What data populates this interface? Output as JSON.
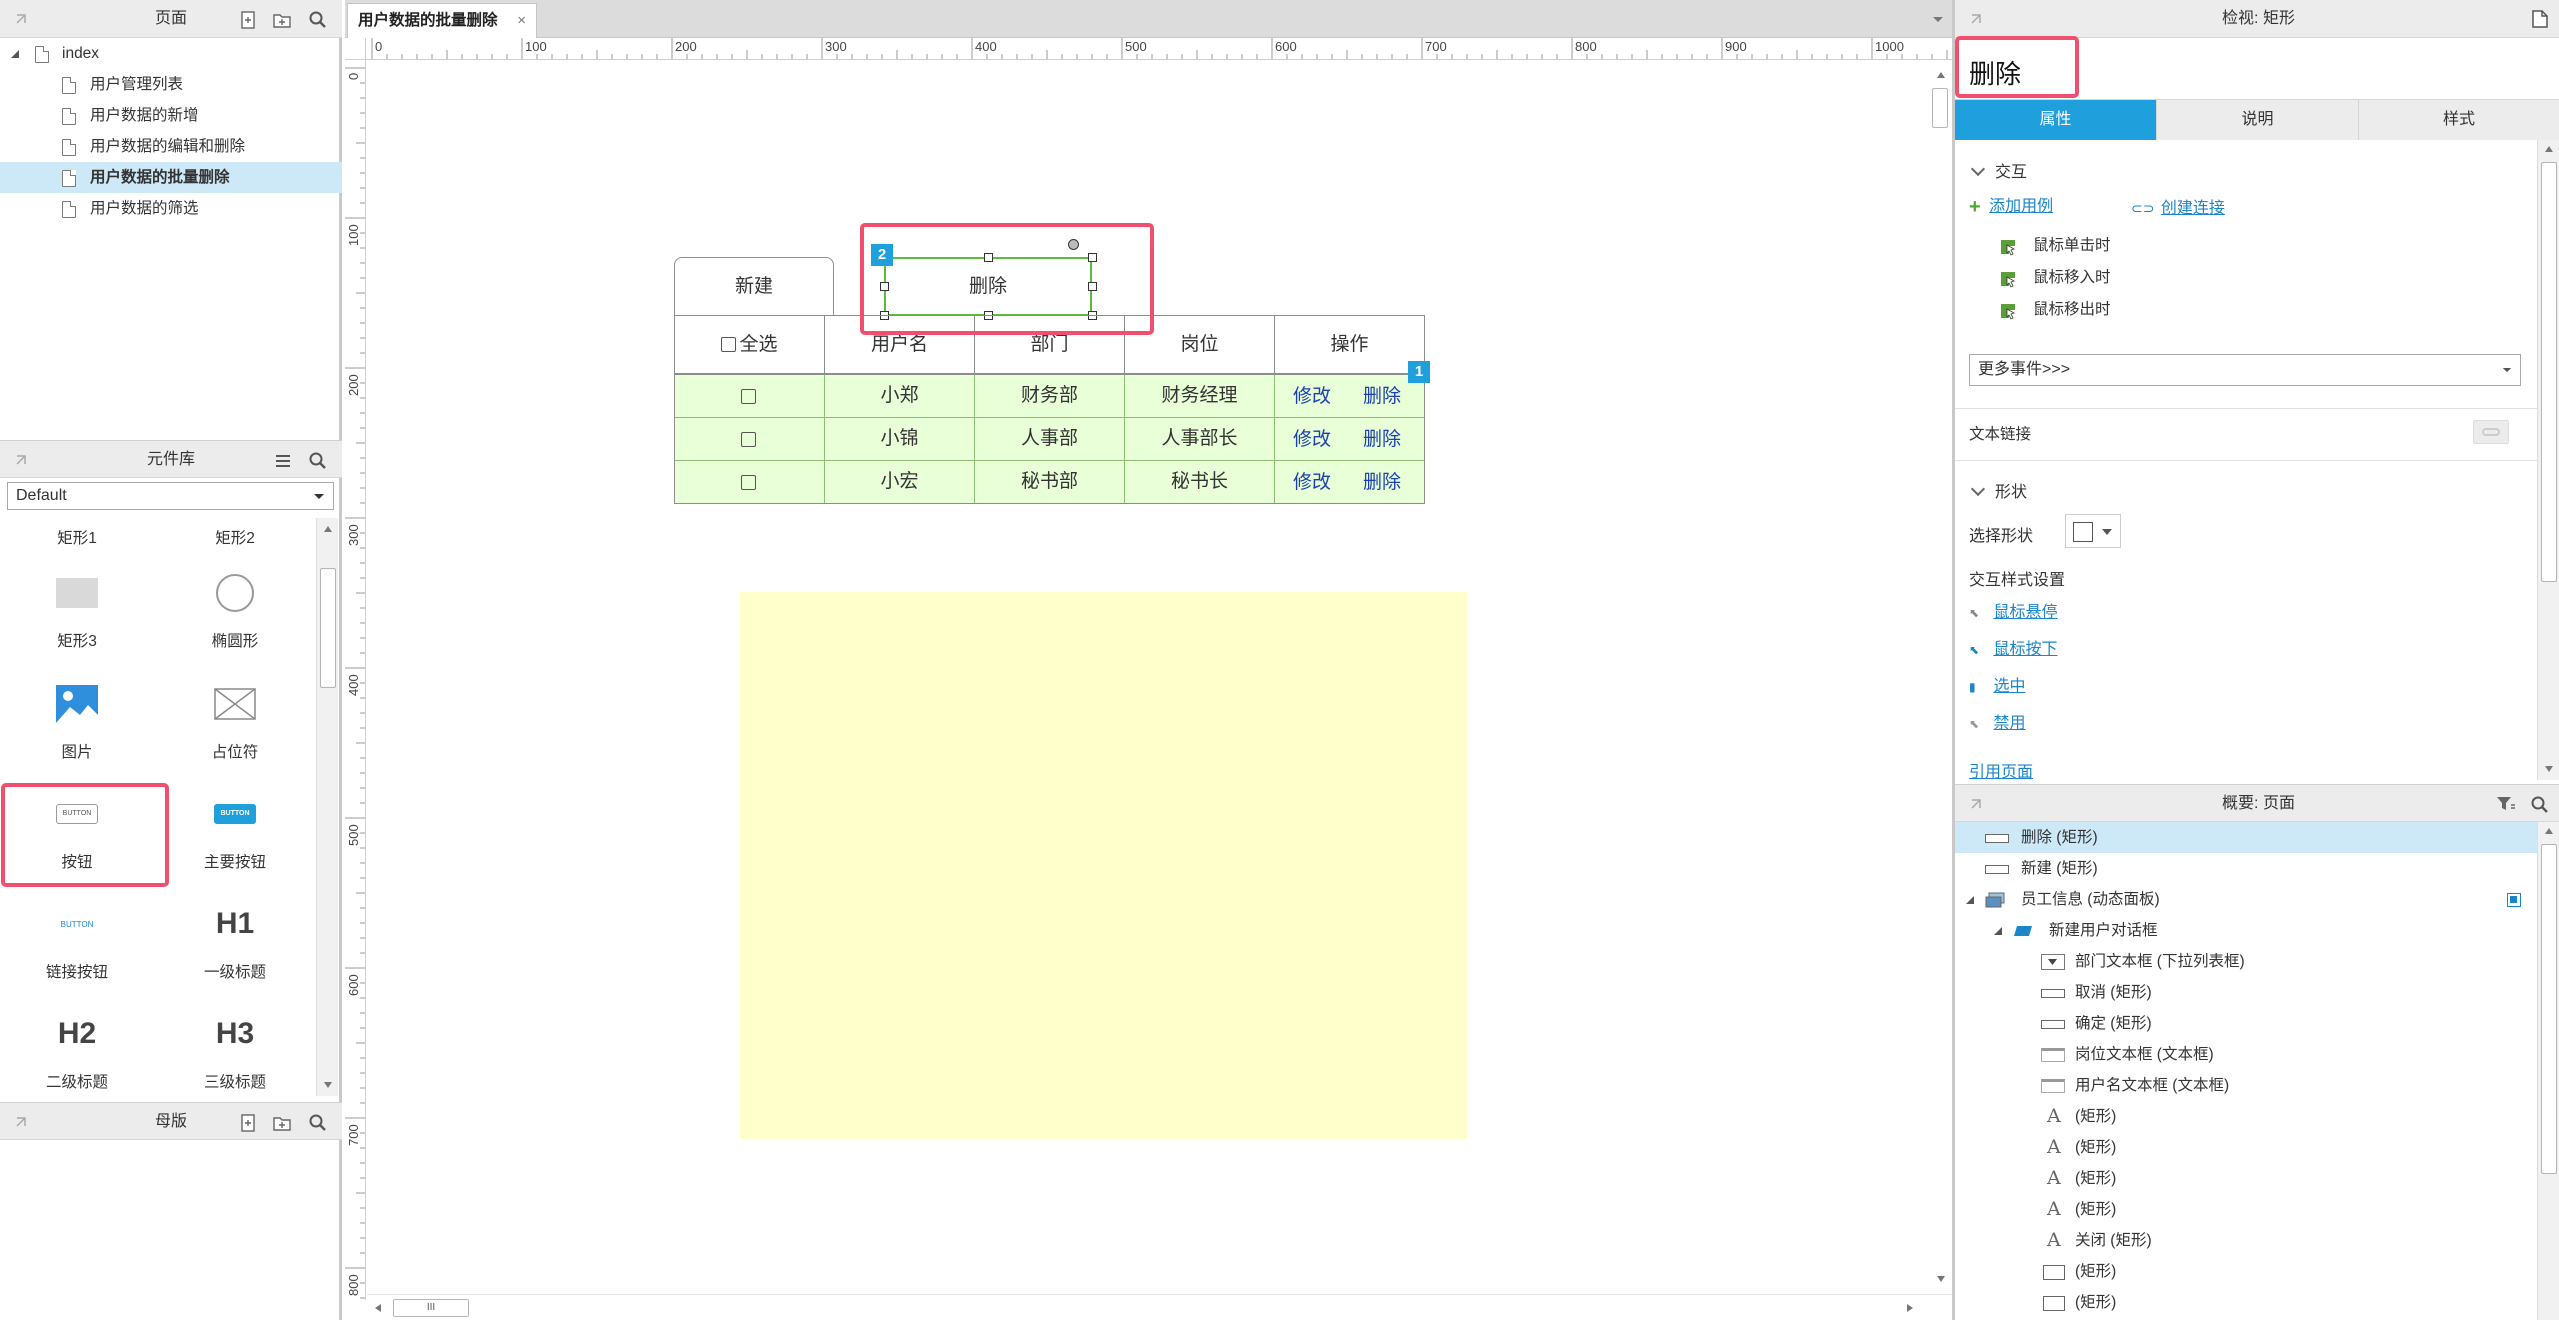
{
  "pages_panel": {
    "title": "页面",
    "items": [
      {
        "label": "index"
      },
      {
        "label": "用户管理列表"
      },
      {
        "label": "用户数据的新增"
      },
      {
        "label": "用户数据的编辑和删除"
      },
      {
        "label": "用户数据的批量删除"
      },
      {
        "label": "用户数据的筛选"
      }
    ]
  },
  "library_panel": {
    "title": "元件库",
    "selected_library": "Default",
    "widgets": [
      {
        "label": "矩形1"
      },
      {
        "label": "矩形2"
      },
      {
        "label": "矩形3"
      },
      {
        "label": "椭圆形"
      },
      {
        "label": "图片"
      },
      {
        "label": "占位符"
      },
      {
        "label": "按钮",
        "glyph": "BUTTON"
      },
      {
        "label": "主要按钮",
        "glyph": "BUTTON"
      },
      {
        "label": "链接按钮",
        "glyph": "BUTTON"
      },
      {
        "label": "一级标题",
        "glyph": "H1"
      },
      {
        "label": "二级标题",
        "glyph": "H2"
      },
      {
        "label": "三级标题",
        "glyph": "H3"
      }
    ]
  },
  "masters_panel": {
    "title": "母版"
  },
  "canvas": {
    "tab_label": "用户数据的批量删除",
    "ruler_h_labels": [
      "0",
      "100",
      "200",
      "300",
      "400",
      "500",
      "600",
      "700",
      "800",
      "900",
      "1000"
    ],
    "ruler_v_labels": [
      "0",
      "100",
      "200",
      "300",
      "400",
      "500",
      "600",
      "700",
      "800"
    ],
    "new_button": "新建",
    "delete_button": "删除",
    "badge_selected": "2",
    "badge_panel": "1",
    "table": {
      "headers": [
        "全选",
        "用户名",
        "部门",
        "岗位",
        "操作"
      ],
      "rows": [
        {
          "name": "小郑",
          "dept": "财务部",
          "post": "财务经理",
          "edit": "修改",
          "del": "删除"
        },
        {
          "name": "小锦",
          "dept": "人事部",
          "post": "人事部长",
          "edit": "修改",
          "del": "删除"
        },
        {
          "name": "小宏",
          "dept": "秘书部",
          "post": "秘书长",
          "edit": "修改",
          "del": "删除"
        }
      ]
    },
    "hscroll_thumb": "III"
  },
  "inspector": {
    "title": "检视: 矩形",
    "widget_name": "删除",
    "tabs": [
      "属性",
      "说明",
      "样式"
    ],
    "section_interaction": "交互",
    "add_case": "添加用例",
    "create_link": "创建连接",
    "events": [
      "鼠标单击时",
      "鼠标移入时",
      "鼠标移出时"
    ],
    "more_events": "更多事件>>>",
    "text_link": "文本链接",
    "section_shape": "形状",
    "select_shape": "选择形状",
    "interaction_styles": "交互样式设置",
    "style_links": [
      "鼠标悬停",
      "鼠标按下",
      "选中",
      "禁用"
    ],
    "ref_page": "引用页面"
  },
  "outline": {
    "title": "概要: 页面",
    "items": [
      {
        "label": "删除 (矩形)",
        "icon": "rect"
      },
      {
        "label": "新建 (矩形)",
        "icon": "rect"
      },
      {
        "label": "员工信息 (动态面板)",
        "icon": "dynamic-panel"
      },
      {
        "label": "新建用户对话框",
        "icon": "state"
      },
      {
        "label": "部门文本框 (下拉列表框)",
        "icon": "droplist"
      },
      {
        "label": "取消 (矩形)",
        "icon": "rect"
      },
      {
        "label": "确定 (矩形)",
        "icon": "rect"
      },
      {
        "label": "岗位文本框 (文本框)",
        "icon": "textfield"
      },
      {
        "label": "用户名文本框 (文本框)",
        "icon": "textfield"
      },
      {
        "label": "(矩形)",
        "icon": "text"
      },
      {
        "label": "(矩形)",
        "icon": "text"
      },
      {
        "label": "(矩形)",
        "icon": "text"
      },
      {
        "label": "(矩形)",
        "icon": "text"
      },
      {
        "label": "关闭 (矩形)",
        "icon": "text"
      },
      {
        "label": "(矩形)",
        "icon": "rect"
      },
      {
        "label": "(矩形)",
        "icon": "rect"
      }
    ]
  },
  "colors": {
    "accent": "#1fa0dd",
    "highlight_box": "#f0506e",
    "selection": "#cde8f7",
    "table_row": "#e8ffd8",
    "panel_yellow": "#ffffcc"
  }
}
